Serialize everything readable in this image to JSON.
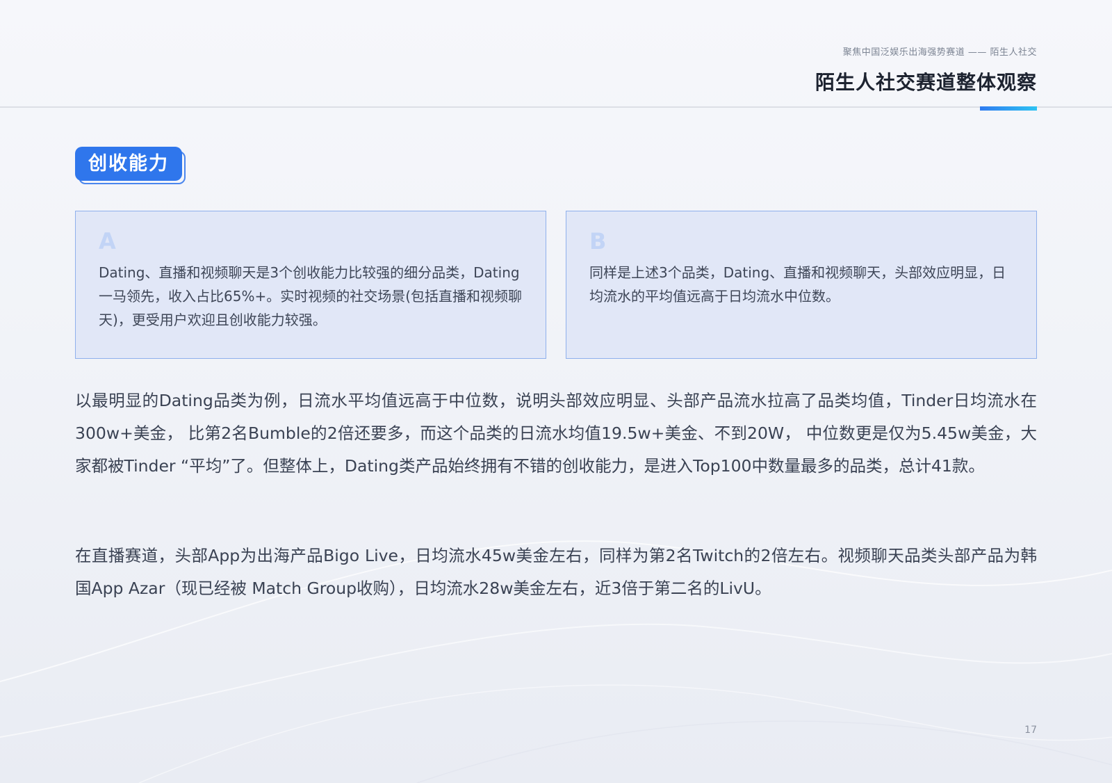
{
  "header": {
    "subtitle": "聚焦中国泛娱乐出海强势赛道 —— 陌生人社交",
    "title": "陌生人社交赛道整体观察"
  },
  "section": {
    "tag": "创收能力"
  },
  "cards": [
    {
      "letter": "A",
      "text": "Dating、直播和视频聊天是3个创收能力比较强的细分品类，Dating一马领先，收入占比65%+。实时视频的社交场景(包括直播和视频聊天)，更受用户欢迎且创收能力较强。"
    },
    {
      "letter": "B",
      "text": "同样是上述3个品类，Dating、直播和视频聊天，头部效应明显，日均流水的平均值远高于日均流水中位数。"
    }
  ],
  "paragraphs": [
    "以最明显的Dating品类为例，日流水平均值远高于中位数，说明头部效应明显、头部产品流水拉高了品类均值，Tinder日均流水在300w+美金， 比第2名Bumble的2倍还要多，而这个品类的日流水均值19.5w+美金、不到20W， 中位数更是仅为5.45w美金，大家都被Tinder “平均”了。但整体上，Dating类产品始终拥有不错的创收能力，是进入Top100中数量最多的品类，总计41款。",
    "在直播赛道，头部App为出海产品Bigo Live，日均流水45w美金左右，同样为第2名Twitch的2倍左右。视频聊天品类头部产品为韩国App Azar（现已经被 Match Group收购），日均流水28w美金左右，近3倍于第二名的LivU。"
  ],
  "page_number": "17"
}
